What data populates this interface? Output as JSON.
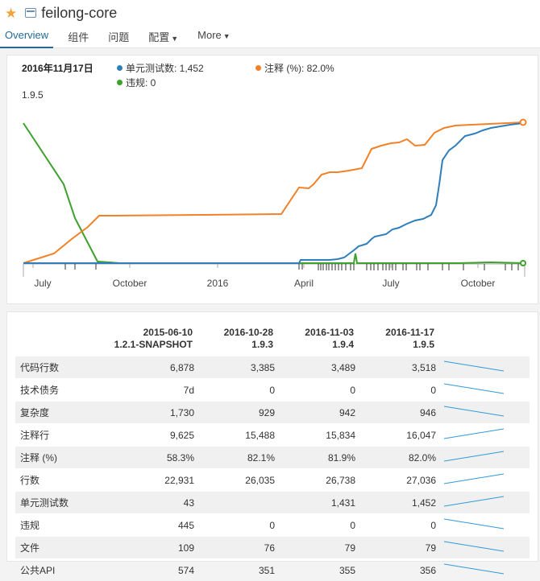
{
  "header": {
    "project_name": "feilong-core",
    "nav": [
      "Overview",
      "组件",
      "问题",
      "配置",
      "More"
    ]
  },
  "legend": {
    "date": "2016年11月17日",
    "version": "1.9.5",
    "items": [
      {
        "label": "单元测试数: 1,452",
        "color": "#2f7ebc"
      },
      {
        "label": "注释 (%): 82.0%",
        "color": "#f28127"
      },
      {
        "label": "违规: 0",
        "color": "#3ca22c"
      }
    ]
  },
  "chart_data": {
    "type": "line",
    "x_ticks": [
      "July",
      "October",
      "2016",
      "April",
      "July",
      "October"
    ],
    "series": [
      {
        "name": "单元测试数",
        "color": "#2f7ebc"
      },
      {
        "name": "注释 (%)",
        "color": "#f28127"
      },
      {
        "name": "违规",
        "color": "#3ca22c"
      }
    ]
  },
  "table": {
    "columns": [
      {
        "date": "2015-06-10",
        "version": "1.2.1-SNAPSHOT"
      },
      {
        "date": "2016-10-28",
        "version": "1.9.3"
      },
      {
        "date": "2016-11-03",
        "version": "1.9.4"
      },
      {
        "date": "2016-11-17",
        "version": "1.9.5"
      }
    ],
    "rows": [
      {
        "metric": "代码行数",
        "values": [
          "6,878",
          "3,385",
          "3,489",
          "3,518"
        ],
        "trend": "down"
      },
      {
        "metric": "技术债务",
        "values": [
          "7d",
          "0",
          "0",
          "0"
        ],
        "trend": "down"
      },
      {
        "metric": "复杂度",
        "values": [
          "1,730",
          "929",
          "942",
          "946"
        ],
        "trend": "down"
      },
      {
        "metric": "注释行",
        "values": [
          "9,625",
          "15,488",
          "15,834",
          "16,047"
        ],
        "trend": "up"
      },
      {
        "metric": "注释 (%)",
        "values": [
          "58.3%",
          "82.1%",
          "81.9%",
          "82.0%"
        ],
        "trend": "up"
      },
      {
        "metric": "行数",
        "values": [
          "22,931",
          "26,035",
          "26,738",
          "27,036"
        ],
        "trend": "up"
      },
      {
        "metric": "单元测试数",
        "values": [
          "43",
          "",
          "1,431",
          "1,452"
        ],
        "trend": "up"
      },
      {
        "metric": "违规",
        "values": [
          "445",
          "0",
          "0",
          "0"
        ],
        "trend": "down"
      },
      {
        "metric": "文件",
        "values": [
          "109",
          "76",
          "79",
          "79"
        ],
        "trend": "down"
      },
      {
        "metric": "公共API",
        "values": [
          "574",
          "351",
          "355",
          "356"
        ],
        "trend": "down"
      }
    ],
    "sparkline_color": "#2f9bd7"
  }
}
